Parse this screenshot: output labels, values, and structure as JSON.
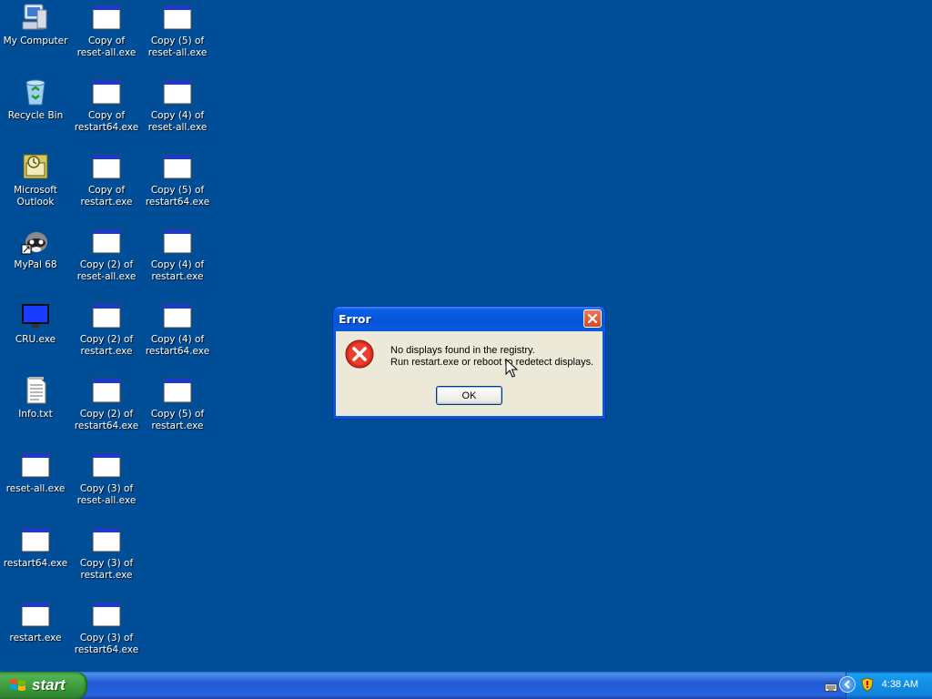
{
  "desktop": {
    "icons": [
      {
        "label": "My Computer",
        "icon": "my-computer-icon"
      },
      {
        "label": "Recycle Bin",
        "icon": "recycle-bin-icon"
      },
      {
        "label": "Microsoft\nOutlook",
        "icon": "outlook-icon"
      },
      {
        "label": "MyPal 68",
        "icon": "mypal-icon"
      },
      {
        "label": "CRU.exe",
        "icon": "monitor-icon"
      },
      {
        "label": "Info.txt",
        "icon": "text-file-icon"
      },
      {
        "label": "reset-all.exe",
        "icon": "exe-window-icon"
      },
      {
        "label": "restart64.exe",
        "icon": "exe-window-icon"
      },
      {
        "label": "restart.exe",
        "icon": "exe-window-icon"
      },
      {
        "label": "Copy of\nreset-all.exe",
        "icon": "exe-window-icon"
      },
      {
        "label": "Copy of\nrestart64.exe",
        "icon": "exe-window-icon"
      },
      {
        "label": "Copy of\nrestart.exe",
        "icon": "exe-window-icon"
      },
      {
        "label": "Copy (2) of\nreset-all.exe",
        "icon": "exe-window-icon"
      },
      {
        "label": "Copy (2) of\nrestart.exe",
        "icon": "exe-window-icon"
      },
      {
        "label": "Copy (2) of\nrestart64.exe",
        "icon": "exe-window-icon"
      },
      {
        "label": "Copy (3) of\nreset-all.exe",
        "icon": "exe-window-icon"
      },
      {
        "label": "Copy (3) of\nrestart.exe",
        "icon": "exe-window-icon"
      },
      {
        "label": "Copy (3) of\nrestart64.exe",
        "icon": "exe-window-icon"
      },
      {
        "label": "Copy (5) of\nreset-all.exe",
        "icon": "exe-window-icon"
      },
      {
        "label": "Copy (4) of\nreset-all.exe",
        "icon": "exe-window-icon"
      },
      {
        "label": "Copy (5) of\nrestart64.exe",
        "icon": "exe-window-icon"
      },
      {
        "label": "Copy (4) of\nrestart.exe",
        "icon": "exe-window-icon"
      },
      {
        "label": "Copy (4) of\nrestart64.exe",
        "icon": "exe-window-icon"
      },
      {
        "label": "Copy (5) of\nrestart.exe",
        "icon": "exe-window-icon"
      }
    ]
  },
  "dialog": {
    "title": "Error",
    "message_line1": "No displays found in the registry.",
    "message_line2": "Run restart.exe or reboot to redetect displays.",
    "ok_label": "OK"
  },
  "taskbar": {
    "start_label": "start",
    "clock": "4:38 AM"
  },
  "colors": {
    "desktop_bg": "#004e98",
    "taskbar_blue": "#2157d7",
    "start_green": "#3a9a3a",
    "dialog_face": "#ece9d8",
    "error_red": "#d82c1c"
  }
}
